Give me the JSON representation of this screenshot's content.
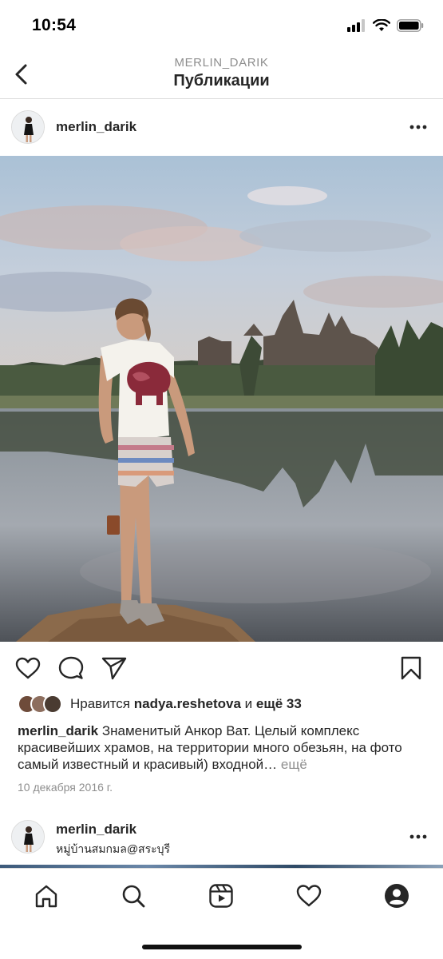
{
  "status_bar": {
    "time": "10:54"
  },
  "header": {
    "username": "MERLIN_DARIK",
    "title": "Публикации"
  },
  "post": {
    "username": "merlin_darik",
    "likes": {
      "prefix": "Нравится",
      "user": "nadya.reshetova",
      "joiner": "и",
      "rest": "ещё 33"
    },
    "caption": {
      "username": "merlin_darik",
      "text": "Знаменитый Анкор Ват. Целый комплекс красивейших храмов, на территории много обезьян, на фото самый известный и красивый) входной…",
      "more": "ещё"
    },
    "date": "10 декабря 2016 г."
  },
  "next_post": {
    "username": "merlin_darik",
    "location": "หมู่บ้านสมกมล@สระบุรี"
  },
  "icons": {
    "back": "chevron-left-icon",
    "more": "more-horizontal-icon",
    "like": "heart-icon",
    "comment": "comment-icon",
    "share": "send-icon",
    "save": "bookmark-icon",
    "nav": [
      "home-icon",
      "search-icon",
      "reels-icon",
      "activity-heart-icon",
      "profile-icon"
    ]
  },
  "colors": {
    "text": "#262626",
    "secondary": "#8e8e8e",
    "divider": "#dbdbdb"
  }
}
